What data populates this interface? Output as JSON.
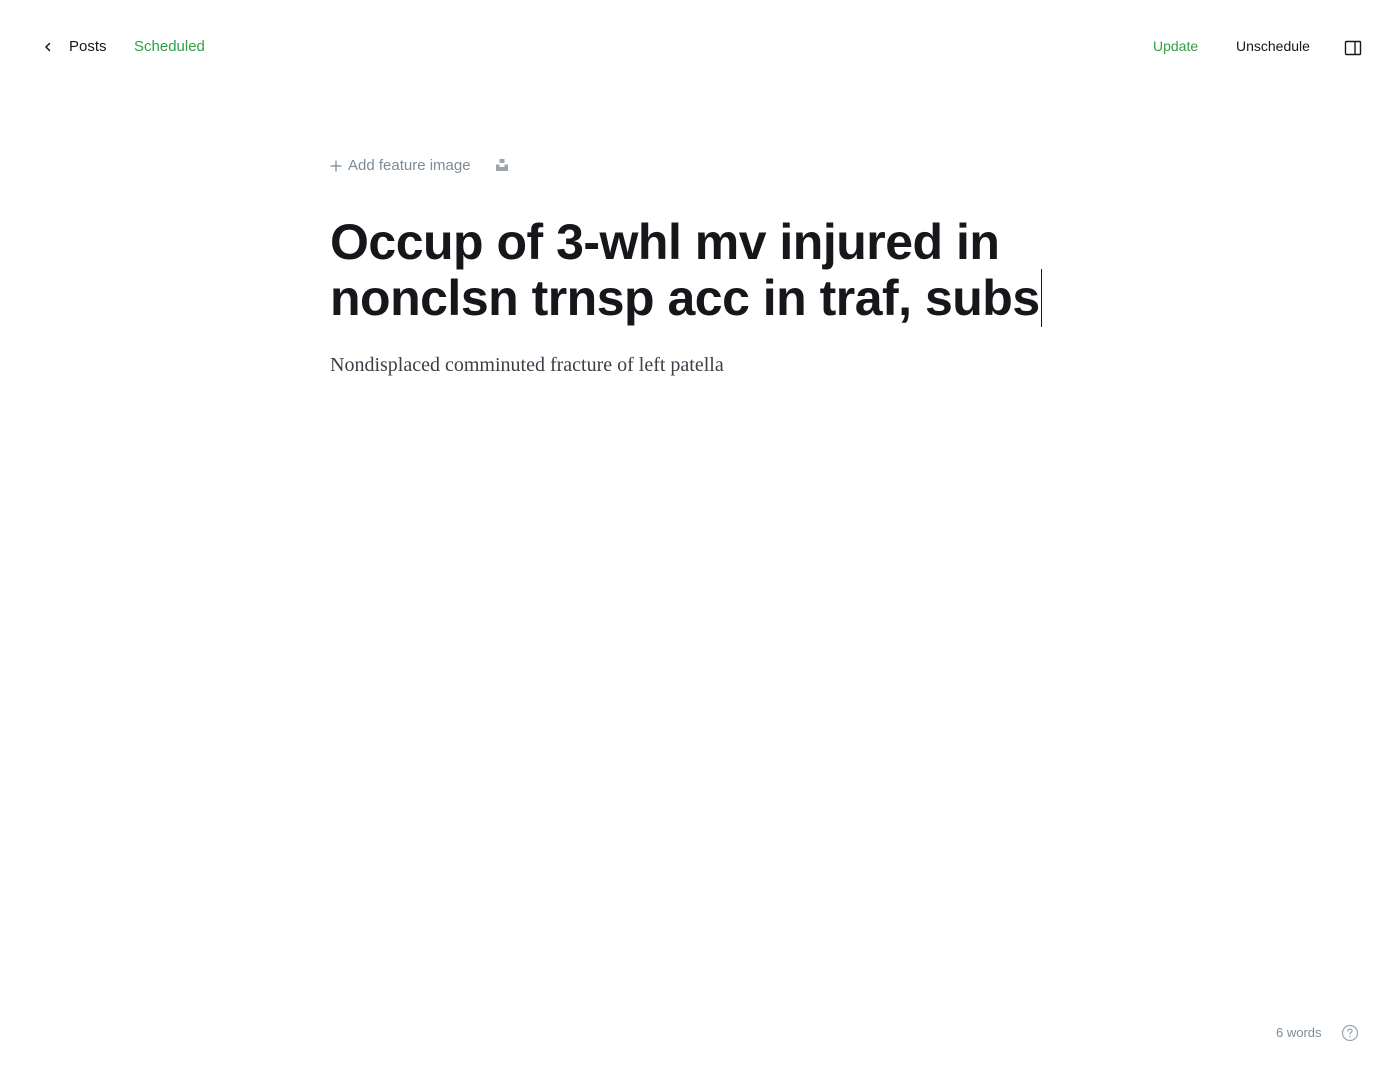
{
  "header": {
    "back_label": "Posts",
    "status": "Scheduled",
    "update_label": "Update",
    "unschedule_label": "Unschedule"
  },
  "editor": {
    "add_feature_image": "Add feature image",
    "title": "Occup of 3-whl mv injured in nonclsn trnsp acc in traf, subs",
    "excerpt": "Nondisplaced comminuted fracture of left patella"
  },
  "footer": {
    "word_count": "6 words"
  },
  "colors": {
    "accent_green": "#30a046",
    "muted": "#7c8b9a",
    "text": "#15171a"
  },
  "icons": {
    "back": "chevron-left-icon",
    "sidebar": "sidebar-toggle-icon",
    "add": "plus-icon",
    "unsplash": "unsplash-icon",
    "help": "help-icon"
  }
}
